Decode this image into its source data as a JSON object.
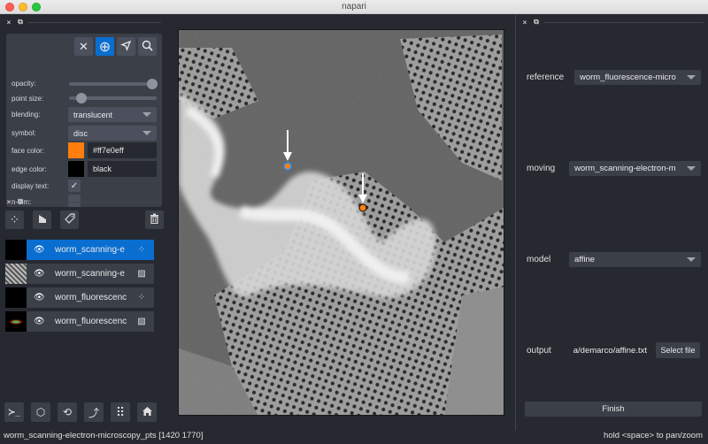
{
  "window": {
    "title": "napari"
  },
  "controls": {
    "tools": [
      {
        "name": "delete-points",
        "glyph": "✕"
      },
      {
        "name": "add-points",
        "glyph": "⊕",
        "active": true
      },
      {
        "name": "select-points",
        "glyph": "➤"
      },
      {
        "name": "pan-zoom",
        "glyph": "⌕"
      }
    ],
    "opacity_label": "opacity:",
    "opacity_value": 1.0,
    "point_size_label": "point size:",
    "point_size_value": 0.1,
    "blending_label": "blending:",
    "blending_value": "translucent",
    "symbol_label": "symbol:",
    "symbol_value": "disc",
    "face_color_label": "face color:",
    "face_color_value": "#ff7e0eff",
    "face_color_hex": "#ff7e0e",
    "edge_color_label": "edge color:",
    "edge_color_value": "black",
    "edge_color_hex": "#000000",
    "display_text_label": "display text:",
    "display_text_checked": true,
    "ndim_label": "n-dim:",
    "ndim_checked": false
  },
  "layer_buttons": {
    "new_points": "⁘",
    "new_shapes": "◣",
    "new_labels": "⌂",
    "delete": "🗑"
  },
  "layers": [
    {
      "name": "worm_scanning-e",
      "type": "points",
      "type_glyph": "⁘",
      "selected": true,
      "visible": true
    },
    {
      "name": "worm_scanning-e",
      "type": "image",
      "type_glyph": "▨",
      "selected": false,
      "visible": true
    },
    {
      "name": "worm_fluorescenc",
      "type": "points",
      "type_glyph": "⁘",
      "selected": false,
      "visible": true
    },
    {
      "name": "worm_fluorescenc",
      "type": "image",
      "type_glyph": "▨",
      "selected": false,
      "visible": true
    }
  ],
  "viewer_buttons": [
    {
      "name": "console",
      "glyph": "≻_"
    },
    {
      "name": "ndisplay",
      "glyph": "⬡"
    },
    {
      "name": "roll-dims",
      "glyph": "⟲"
    },
    {
      "name": "transpose-dims",
      "glyph": "⤴"
    },
    {
      "name": "grid-view",
      "glyph": "⠿"
    },
    {
      "name": "reset-view",
      "glyph": "⌂"
    }
  ],
  "registration": {
    "reference_label": "reference",
    "reference_value": "worm_fluorescence-micro",
    "moving_label": "moving",
    "moving_value": "worm_scanning-electron-m",
    "model_label": "model",
    "model_value": "affine",
    "output_label": "output",
    "output_value": "a/demarco/affine.txt",
    "select_file_label": "Select file",
    "finish_label": "Finish"
  },
  "status": {
    "left": "worm_scanning-electron-microscopy_pts [1420 1770]",
    "right": "hold <space> to pan/zoom"
  },
  "colors": {
    "accent": "#0a6ed1",
    "point_face": "#ff7e0e",
    "point_edge_selected": "#1e90ff"
  }
}
